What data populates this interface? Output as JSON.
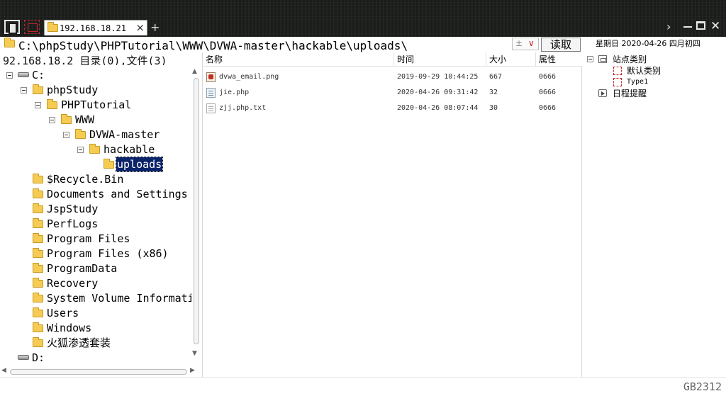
{
  "window": {
    "tab_title": "192.168.18.21",
    "tab_close": "×",
    "tab_add": "+",
    "nav_next": "›",
    "close_glyph": "✕"
  },
  "address_bar": {
    "path": "C:\\phpStudy\\PHPTutorial\\WWW\\DVWA-master\\hackable\\uploads\\",
    "dropdown_pm": "±",
    "dropdown_chevron": "∨",
    "read_button": "读取"
  },
  "left_status": "92.168.18.2    目录(0),文件(3)",
  "tree": {
    "drive_c": "C:",
    "phpstudy": "phpStudy",
    "phptutorial": "PHPTutorial",
    "www": "WWW",
    "dvwa": "DVWA-master",
    "hackable": "hackable",
    "uploads": "uploads",
    "c_folders": [
      "$Recycle.Bin",
      "Documents and Settings",
      "JspStudy",
      "PerfLogs",
      "Program Files",
      "Program Files (x86)",
      "ProgramData",
      "Recovery",
      "System Volume Information",
      "Users",
      "Windows",
      "火狐渗透套装"
    ],
    "drive_d": "D:",
    "scroll_up": "▲",
    "scroll_down": "▼",
    "scroll_left": "◀",
    "scroll_right": "▶"
  },
  "file_list": {
    "headers": {
      "name": "名称",
      "time": "时间",
      "size": "大小",
      "attr": "属性"
    },
    "rows": [
      {
        "name": "dvwa_email.png",
        "time": "2019-09-29 10:44:25",
        "size": "667",
        "attr": "0666",
        "icon": "image-file-icon"
      },
      {
        "name": "jie.php",
        "time": "2020-04-26 09:31:42",
        "size": "32",
        "attr": "0666",
        "icon": "php-file-icon"
      },
      {
        "name": "zjj.php.txt",
        "time": "2020-04-26 08:07:44",
        "size": "30",
        "attr": "0666",
        "icon": "text-file-icon"
      }
    ]
  },
  "right_panel": {
    "date": "星期日 2020-04-26 四月初四",
    "site_category": "站点类别",
    "default_category": "默认类别",
    "type1": "Type1",
    "schedule": "日程提醒"
  },
  "status_bar": {
    "encoding": "GB2312"
  },
  "colors": {
    "titlebar_bg": "#1a1c1a",
    "selection_bg": "#0a246a",
    "folder_yellow": "#f5cb52",
    "accent_red": "#c0262a"
  }
}
